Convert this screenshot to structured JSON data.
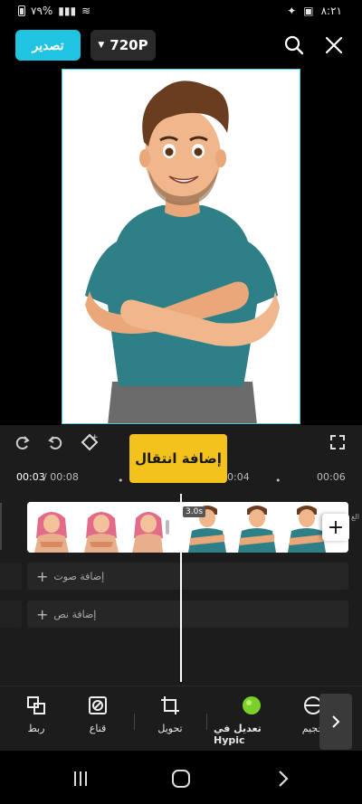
{
  "status": {
    "battery": "٧٩%",
    "time": "٨:٢١"
  },
  "toolbar": {
    "export_label": "تصدير",
    "resolution": "720P"
  },
  "tooltip": {
    "text": "إضافة انتقال"
  },
  "ruler": {
    "current": "00:03",
    "total": "/ 00:08",
    "mark_a": "00:04",
    "mark_b": "00:06"
  },
  "timeline": {
    "duration_badge": "3.0s",
    "side_label": "الغ",
    "add_audio": "إضافة صوت",
    "add_text": "إضافة نص"
  },
  "tools": [
    {
      "label": "ربط",
      "icon": "link-icon"
    },
    {
      "label": "قناع",
      "icon": "mask-icon"
    },
    {
      "label": "تحويل",
      "icon": "crop-icon"
    },
    {
      "label": "تعديل في Hypic",
      "icon": "hypic-icon"
    },
    {
      "label": "حجيم",
      "icon": "resize-icon"
    }
  ],
  "colors": {
    "accent": "#20c3e0",
    "tooltip": "#f4c21c",
    "hypic_green": "#7bd12a"
  }
}
